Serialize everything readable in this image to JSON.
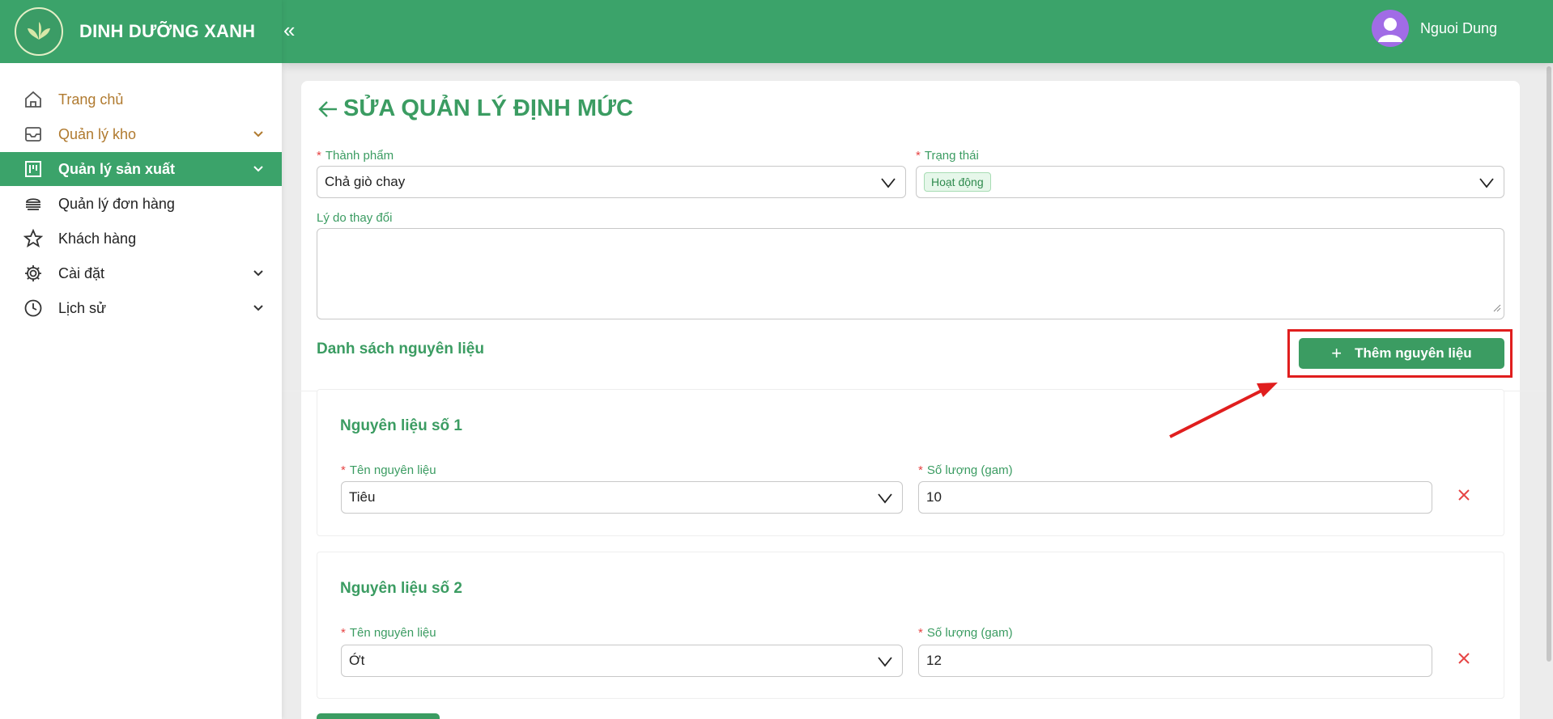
{
  "brand": {
    "name": "DINH DƯỠNG XANH"
  },
  "header": {
    "collapse_icon": "«",
    "username": "Nguoi Dung"
  },
  "sidebar": {
    "items": [
      {
        "label": "Trang chủ",
        "icon": "home-icon"
      },
      {
        "label": "Quản lý kho",
        "icon": "inbox-icon"
      },
      {
        "label": "Quản lý sản xuất",
        "icon": "board-icon"
      },
      {
        "label": "Quản lý đơn hàng",
        "icon": "order-icon"
      },
      {
        "label": "Khách hàng",
        "icon": "star-icon"
      },
      {
        "label": "Cài đặt",
        "icon": "gear-icon"
      },
      {
        "label": "Lịch sử",
        "icon": "clock-icon"
      }
    ]
  },
  "page": {
    "title": "SỬA QUẢN LÝ ĐỊNH MỨC"
  },
  "form": {
    "product_label": "Thành phẩm",
    "product_value": "Chả giò chay",
    "status_label": "Trạng thái",
    "status_value": "Hoạt động",
    "reason_label": "Lý do thay đổi",
    "reason_value": ""
  },
  "ingredients": {
    "section_title": "Danh sách nguyên liệu",
    "add_button": "Thêm nguyên liệu",
    "items": [
      {
        "title": "Nguyên liệu số 1",
        "name_label": "Tên nguyên liệu",
        "name_value": "Tiêu",
        "qty_label": "Số lượng (gam)",
        "qty_value": "10"
      },
      {
        "title": "Nguyên liệu số 2",
        "name_label": "Tên nguyên liệu",
        "name_value": "Ớt",
        "qty_label": "Số lượng (gam)",
        "qty_value": "12"
      }
    ]
  },
  "colors": {
    "primary": "#3ba36a",
    "accent_text": "#3b9c62",
    "required": "#e64545",
    "annotation": "#e01e1e"
  }
}
